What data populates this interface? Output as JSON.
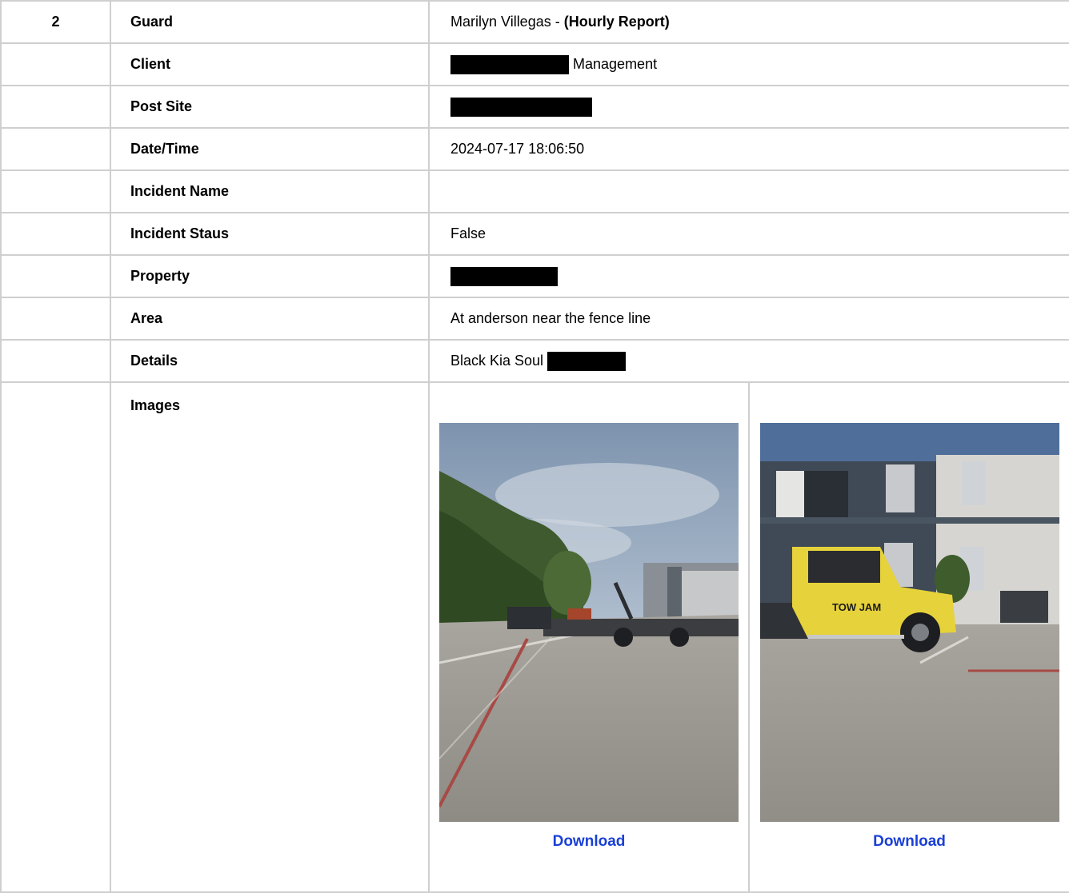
{
  "report": {
    "row_number": "2",
    "rows": {
      "guard": {
        "label": "Guard",
        "value_name": "Marilyn Villegas - ",
        "value_type": "(Hourly Report)"
      },
      "client": {
        "label": "Client",
        "value_suffix": "Management"
      },
      "post_site": {
        "label": "Post Site"
      },
      "datetime": {
        "label": "Date/Time",
        "value": "2024-07-17 18:06:50"
      },
      "incident_name": {
        "label": "Incident Name",
        "value": ""
      },
      "incident_status": {
        "label": "Incident Staus",
        "value": "False"
      },
      "property": {
        "label": "Property"
      },
      "area": {
        "label": "Area",
        "value": "At anderson near the fence line"
      },
      "details": {
        "label": "Details",
        "value": "Black Kia Soul"
      },
      "images": {
        "label": "Images"
      }
    },
    "images": [
      {
        "download_label": "Download"
      },
      {
        "download_label": "Download"
      }
    ]
  },
  "colors": {
    "link": "#1a3fd6",
    "border": "#cfcfcf",
    "redaction": "#000000"
  },
  "tow_sign": {
    "text": "TOW JAM"
  }
}
